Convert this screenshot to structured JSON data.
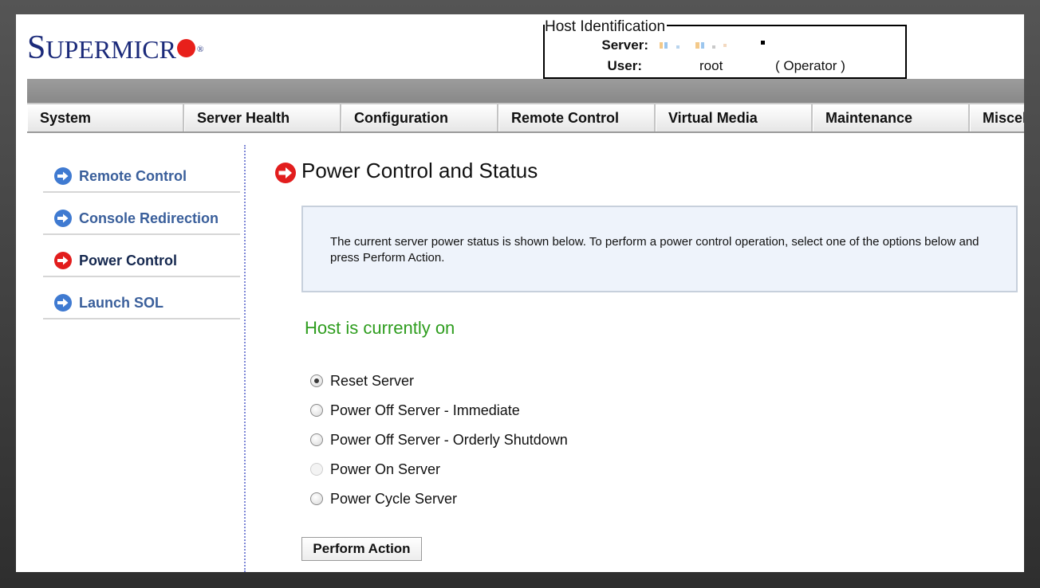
{
  "brand": {
    "logo_text_s": "S",
    "logo_text_rest": "UPERMICR",
    "logo_reg": "®"
  },
  "host": {
    "legend": "Host Identification",
    "server_label": "Server:",
    "user_label": "User:",
    "user_value": "root",
    "user_role": "( Operator )"
  },
  "nav": {
    "tabs": [
      {
        "label": "System"
      },
      {
        "label": "Server Health"
      },
      {
        "label": "Configuration"
      },
      {
        "label": "Remote Control"
      },
      {
        "label": "Virtual Media"
      },
      {
        "label": "Maintenance"
      },
      {
        "label": "Miscellaneous"
      }
    ]
  },
  "sidebar": {
    "items": [
      {
        "label": "Remote Control",
        "icon": "arrow-right-blue-icon"
      },
      {
        "label": "Console Redirection",
        "icon": "arrow-right-blue-icon"
      },
      {
        "label": "Power Control",
        "icon": "arrow-right-red-icon",
        "active": true
      },
      {
        "label": "Launch SOL",
        "icon": "arrow-right-blue-icon"
      }
    ]
  },
  "main": {
    "title": "Power Control and Status",
    "info": "The current server power status is shown below. To perform a power control operation, select one of the options below and press Perform Action.",
    "status": "Host is currently on",
    "options": [
      {
        "label": "Reset Server",
        "checked": true,
        "disabled": false
      },
      {
        "label": "Power Off Server - Immediate",
        "checked": false,
        "disabled": false
      },
      {
        "label": "Power Off Server - Orderly Shutdown",
        "checked": false,
        "disabled": false
      },
      {
        "label": "Power On Server",
        "checked": false,
        "disabled": true
      },
      {
        "label": "Power Cycle Server",
        "checked": false,
        "disabled": false
      }
    ],
    "action_button": "Perform Action"
  },
  "colors": {
    "brand_blue": "#1b2a7a",
    "brand_red": "#e8201b",
    "status_green": "#2e9d1e",
    "link_blue": "#3a5f9b",
    "info_bg": "#eef3fb"
  }
}
